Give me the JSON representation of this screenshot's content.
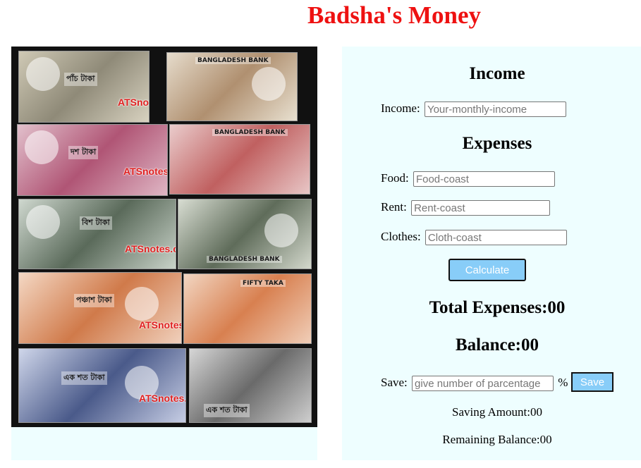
{
  "page": {
    "title": "Badsha's Money"
  },
  "notes_image": {
    "notes": [
      {
        "stamp": "পাঁচ টাকা",
        "watermark": "ATSnotes.com",
        "color": "#8a8a78"
      },
      {
        "stamp": "BANGLADESH BANK",
        "color": "#a08060"
      },
      {
        "stamp": "দশ টাকা",
        "watermark": "ATSnotes.com",
        "color": "#b05575"
      },
      {
        "stamp": "BANGLADESH BANK",
        "color": "#c06060"
      },
      {
        "stamp": "বিশ টাকা",
        "watermark": "ATSnotes.com",
        "color": "#5a6a5a"
      },
      {
        "stamp": "BANGLADESH BANK",
        "color": "#5f6c5a"
      },
      {
        "stamp": "পঞ্চাশ টাকা",
        "watermark": "ATSnotes.com",
        "color": "#d07a4a"
      },
      {
        "stamp": "FIFTY TAKA",
        "color": "#d88050"
      },
      {
        "stamp": "এক শত টাকা",
        "watermark": "ATSnotes.com",
        "color": "#4a5a8a"
      },
      {
        "stamp": "এক শত টাকা",
        "color": "#6a6a6a"
      }
    ]
  },
  "income": {
    "heading": "Income",
    "label": "Income:",
    "placeholder": "Your-monthly-income"
  },
  "expenses": {
    "heading": "Expenses",
    "food_label": "Food:",
    "food_placeholder": "Food-coast",
    "rent_label": "Rent:",
    "rent_placeholder": "Rent-coast",
    "clothes_label": "Clothes:",
    "clothes_placeholder": "Cloth-coast",
    "calculate_label": "Calculate"
  },
  "summary": {
    "total_expenses": "Total Expenses:00",
    "balance": "Balance:00"
  },
  "saving": {
    "label": "Save:",
    "placeholder": "give number of parcentage",
    "percent_sign": "%",
    "save_label": "Save",
    "saving_amount": "Saving Amount:00",
    "remaining_balance": "Remaining Balance:00"
  }
}
